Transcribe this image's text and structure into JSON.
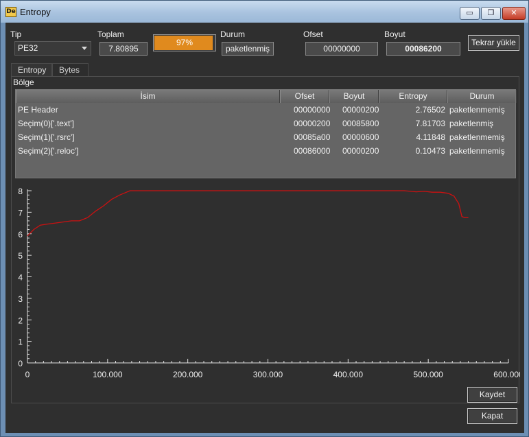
{
  "window": {
    "title": "Entropy",
    "icon_text": "De",
    "min_glyph": "▭",
    "max_glyph": "❐",
    "close_glyph": "✕"
  },
  "top": {
    "tip_label": "Tip",
    "tip_value": "PE32",
    "toplam_label": "Toplam",
    "toplam_value": "7.80895",
    "progress_percent": 97,
    "progress_text": "97%",
    "durum_label": "Durum",
    "durum_value": "paketlenmiş",
    "ofset_label": "Ofset",
    "ofset_value": "00000000",
    "boyut_label": "Boyut",
    "boyut_value": "00086200",
    "reload_label": "Tekrar yükle"
  },
  "tabs": [
    {
      "label": "Entropy"
    },
    {
      "label": "Bytes"
    }
  ],
  "region_label": "Bölge",
  "table": {
    "columns": [
      "İsim",
      "Ofset",
      "Boyut",
      "Entropy",
      "Durum"
    ],
    "rows": [
      [
        "PE Header",
        "00000000",
        "00000200",
        "2.76502",
        "paketlenmemiş"
      ],
      [
        "Seçim(0)['.text']",
        "00000200",
        "00085800",
        "7.81703",
        "paketlenmiş"
      ],
      [
        "Seçim(1)['.rsrc']",
        "00085a00",
        "00000600",
        "4.11848",
        "paketlenmemiş"
      ],
      [
        "Seçim(2)['.reloc']",
        "00086000",
        "00000200",
        "0.10473",
        "paketlenmemiş"
      ]
    ]
  },
  "chart_data": {
    "type": "line",
    "xlim": [
      0,
      600000
    ],
    "ylim": [
      0,
      8
    ],
    "x_ticks": [
      "0",
      "100.000",
      "200.000",
      "300.000",
      "400.000",
      "500.000",
      "600.000"
    ],
    "y_ticks": [
      "0",
      "1",
      "2",
      "3",
      "4",
      "5",
      "6",
      "7",
      "8"
    ],
    "line_color": "#cc1111",
    "series": [
      {
        "x": [
          0,
          8000,
          16000,
          25000,
          35000,
          45000,
          55000,
          65000,
          75000,
          85000,
          95000,
          105000,
          115000,
          128000,
          200000,
          300000,
          400000,
          470000,
          485000,
          495000,
          505000,
          515000,
          525000,
          532000,
          538000,
          542000,
          546000,
          550000
        ],
        "y": [
          5.9,
          6.2,
          6.4,
          6.45,
          6.5,
          6.55,
          6.6,
          6.6,
          6.75,
          7.05,
          7.3,
          7.6,
          7.8,
          8.0,
          8.0,
          8.0,
          8.0,
          8.0,
          7.95,
          7.97,
          7.93,
          7.93,
          7.88,
          7.75,
          7.4,
          6.8,
          6.75,
          6.75
        ]
      }
    ]
  },
  "buttons": {
    "save": "Kaydet",
    "close": "Kapat"
  }
}
